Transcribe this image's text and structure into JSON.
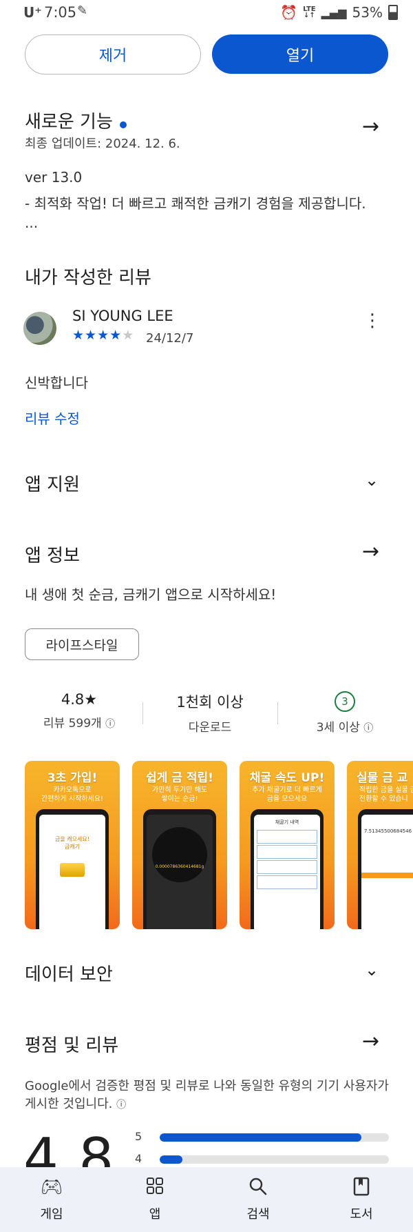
{
  "status_bar": {
    "carrier": "U⁺",
    "time": "7:05",
    "network": "LTE",
    "battery": "53%"
  },
  "actions": {
    "uninstall_label": "제거",
    "open_label": "열기"
  },
  "whats_new": {
    "title": "새로운 기능",
    "updated": "최종 업데이트: 2024. 12. 6.",
    "version": "ver 13.0",
    "notes": "- 최적화 작업! 더 빠르고 쾌적한 금캐기 경험을 제공합니다.",
    "ellipsis": "..."
  },
  "my_review": {
    "title": "내가 작성한 리뷰",
    "author": "SI YOUNG LEE",
    "rating": 4,
    "date": "24/12/7",
    "text": "신박합니다",
    "edit_label": "리뷰 수정"
  },
  "app_support": {
    "title": "앱 지원"
  },
  "app_info": {
    "title": "앱 정보",
    "description": "내 생애 첫 순금, 금캐기 앱으로 시작하세요!",
    "category": "라이프스타일"
  },
  "stats": {
    "rating_value": "4.8★",
    "rating_label": "리뷰 599개",
    "downloads_value": "1천회 이상",
    "downloads_label": "다운로드",
    "age_badge": "3",
    "age_label": "3세 이상"
  },
  "screenshots": [
    {
      "headline": "3초 가입!",
      "sub": "카카오톡으로\n간편하게 시작하세요!",
      "screen_text": "금을 캐으세요!\n금캐기"
    },
    {
      "headline": "쉽게 금 적립!",
      "sub": "가만히 두기만 해도\n쌓이는 순금!",
      "screen_text": "0.0000786360414681g"
    },
    {
      "headline": "채굴 속도 UP!",
      "sub": "추가 채굴기로 더 빠르게\n금을 모으세요",
      "screen_text": "채굴기 내역"
    },
    {
      "headline": "실물 금 교",
      "sub": "적립한 금을 실물 금\n전환할 수 있습니",
      "screen_text": "7.51345500684546"
    }
  ],
  "data_safety": {
    "title": "데이터 보안"
  },
  "ratings_reviews": {
    "title": "평점 및 리뷰",
    "description": "Google에서 검증한 평점 및 리뷰로 나와 동일한 유형의 기기 사용자가 게시한 것입니다.",
    "average": "4.8",
    "distribution": [
      {
        "stars": "5",
        "fraction": 0.88
      },
      {
        "stars": "4",
        "fraction": 0.1
      }
    ]
  },
  "bottom_nav": [
    {
      "label": "게임",
      "icon": "gamepad-icon"
    },
    {
      "label": "앱",
      "icon": "apps-grid-icon"
    },
    {
      "label": "검색",
      "icon": "search-icon"
    },
    {
      "label": "도서",
      "icon": "book-icon"
    }
  ],
  "colors": {
    "accent": "#0b57d0",
    "age_badge": "#188038",
    "bottom_nav_bg": "#eef1f7"
  }
}
